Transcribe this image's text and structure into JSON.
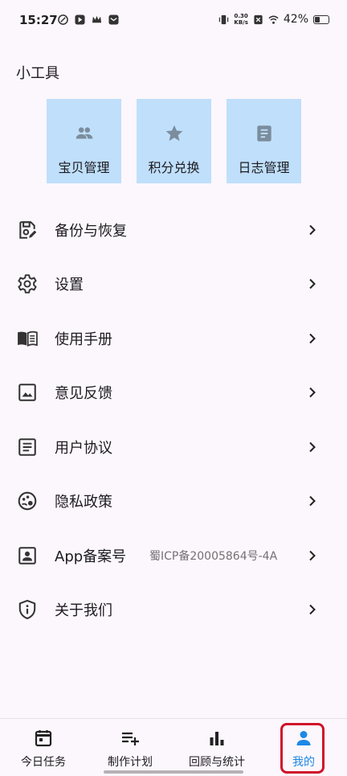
{
  "status_bar": {
    "time": "15:27",
    "net_speed_value": "0.30",
    "net_speed_unit": "KB/s",
    "battery_text": "42%",
    "battery_level": 0.42
  },
  "tools_section": {
    "title": "小工具",
    "items": [
      {
        "label": "宝贝管理",
        "icon": "people-icon"
      },
      {
        "label": "积分兑换",
        "icon": "star-icon"
      },
      {
        "label": "日志管理",
        "icon": "document-icon"
      }
    ]
  },
  "menu": {
    "items": [
      {
        "label": "备份与恢复",
        "icon": "backup-save-icon"
      },
      {
        "label": "设置",
        "icon": "gear-icon"
      },
      {
        "label": "使用手册",
        "icon": "book-icon"
      },
      {
        "label": "意见反馈",
        "icon": "image-icon"
      },
      {
        "label": "用户协议",
        "icon": "document-lines-icon"
      },
      {
        "label": "隐私政策",
        "icon": "privacy-icon"
      },
      {
        "label": "App备案号",
        "icon": "id-badge-icon",
        "extra": "蜀ICP备20005864号-4A"
      },
      {
        "label": "关于我们",
        "icon": "shield-info-icon"
      }
    ]
  },
  "bottom_nav": {
    "items": [
      {
        "label": "今日任务",
        "icon": "calendar-icon"
      },
      {
        "label": "制作计划",
        "icon": "playlist-add-icon"
      },
      {
        "label": "回顾与统计",
        "icon": "bar-chart-icon"
      },
      {
        "label": "我的",
        "icon": "person-icon",
        "active": true
      }
    ]
  },
  "colors": {
    "background": "#fcf7fc",
    "tile": "#bfdffb",
    "accent": "#1e88e5",
    "highlight": "#d0122a"
  }
}
